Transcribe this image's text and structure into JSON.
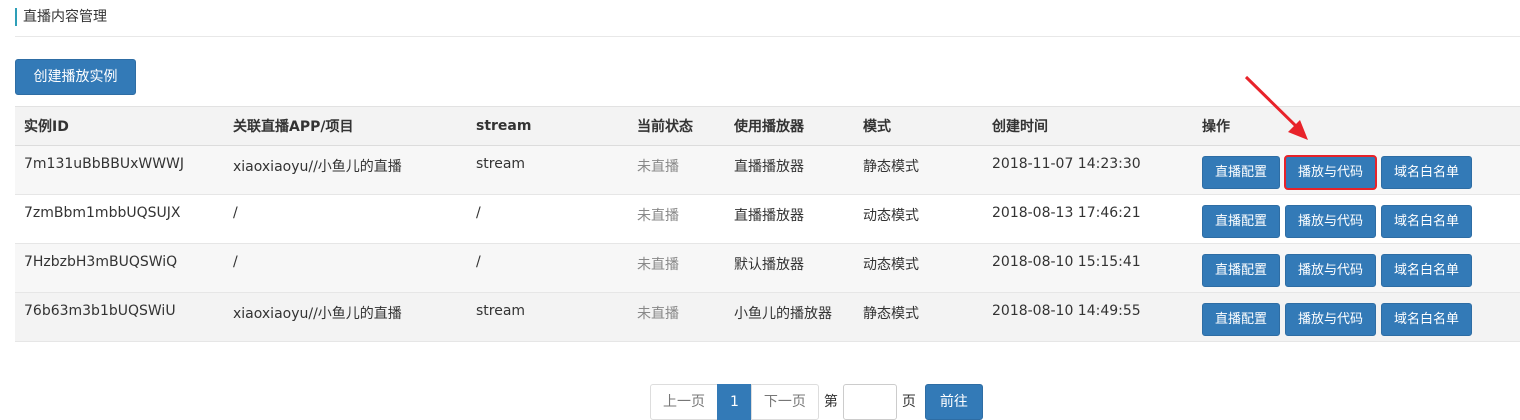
{
  "page_title": "直播内容管理",
  "create_button": "创建播放实例",
  "table": {
    "headers": [
      "实例ID",
      "关联直播APP/项目",
      "stream",
      "当前状态",
      "使用播放器",
      "模式",
      "创建时间",
      "操作"
    ],
    "rows": [
      {
        "id": "7m131uBbBBUxWWWJ",
        "app": "xiaoxiaoyu//小鱼儿的直播",
        "stream": "stream",
        "status": "未直播",
        "player": "直播播放器",
        "mode": "静态模式",
        "created": "2018-11-07 14:23:30"
      },
      {
        "id": "7zmBbm1mbbUQSUJX",
        "app": "/",
        "stream": "/",
        "status": "未直播",
        "player": "直播播放器",
        "mode": "动态模式",
        "created": "2018-08-13 17:46:21"
      },
      {
        "id": "7HzbzbH3mBUQSWiQ",
        "app": "/",
        "stream": "/",
        "status": "未直播",
        "player": "默认播放器",
        "mode": "动态模式",
        "created": "2018-08-10 15:15:41"
      },
      {
        "id": "76b63m3b1bUQSWiU",
        "app": "xiaoxiaoyu//小鱼儿的直播",
        "stream": "stream",
        "status": "未直播",
        "player": "小鱼儿的播放器",
        "mode": "静态模式",
        "created": "2018-08-10 14:49:55"
      }
    ],
    "actions": [
      "直播配置",
      "播放与代码",
      "域名白名单"
    ]
  },
  "pagination": {
    "prev": "上一页",
    "current": "1",
    "next": "下一页",
    "page_prefix": "第",
    "page_suffix": "页",
    "go": "前往",
    "input_value": ""
  },
  "colors": {
    "primary": "#337ab7",
    "highlight": "#e8232a",
    "accent_bar": "#2e9fb8"
  }
}
